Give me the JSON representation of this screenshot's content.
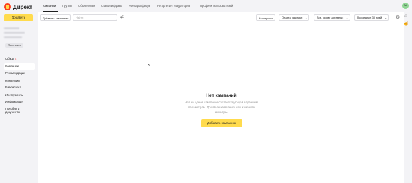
{
  "app": {
    "logo_text": "Директ"
  },
  "sidebar": {
    "add_button": "Добавить",
    "topup_button": "Пополнить",
    "items": [
      {
        "label": "Обзор",
        "tag": "β"
      },
      {
        "label": "Кампании"
      },
      {
        "label": "Рекомендации"
      },
      {
        "label": "Конверсии"
      },
      {
        "label": "Библиотека"
      },
      {
        "label": "Инструменты"
      },
      {
        "label": "Информация"
      },
      {
        "label": "Пособия и документы"
      }
    ]
  },
  "tabs": [
    "Кампании",
    "Группы",
    "Объявления",
    "Ставки и фразы",
    "Фильтры фидов",
    "Ретаргетинг и аудитории",
    "Профили пользователей"
  ],
  "toolbar": {
    "add_campaign": "Добавить кампанию",
    "search_placeholder": "Найти",
    "conversions": "Конверсии",
    "payment": "Оплата за клики",
    "filter": "Все, кроме архивных",
    "period": "Последние 30 дней"
  },
  "user": {
    "initials": "АК"
  },
  "empty_state": {
    "title": "Нет кампаний",
    "description": "Нет ни одной кампании соответствующей заданным параметрам. Добавьте кампанию или измените фильтры.",
    "button": "Добавить кампанию"
  },
  "icons": {
    "refresh": "refresh-icon",
    "gear": "gear-icon",
    "chevron": "chevron-down-icon",
    "bell": "bell-icon",
    "thumb": "thumb-icon",
    "cursor": "cursor-icon"
  },
  "colors": {
    "accent": "#ffdb4d",
    "logo_red": "#fc3f1d",
    "avatar": "#8fd694"
  }
}
